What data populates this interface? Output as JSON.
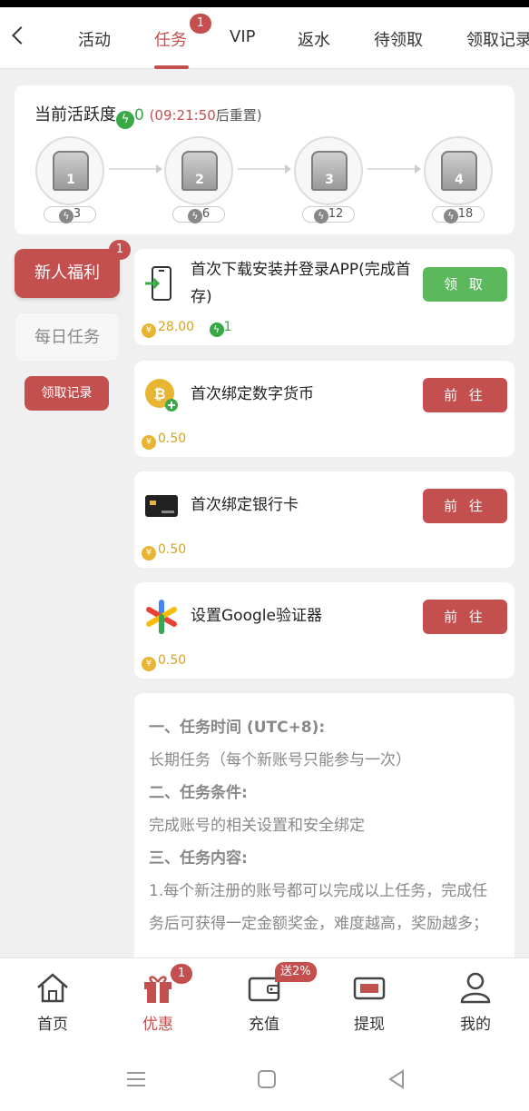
{
  "topnav": {
    "tabs": [
      {
        "label": "活动"
      },
      {
        "label": "任务",
        "badge": "1"
      },
      {
        "label": "VIP"
      },
      {
        "label": "返水"
      },
      {
        "label": "待领取"
      },
      {
        "label": "领取记录"
      }
    ],
    "active_tab": "任务"
  },
  "activity": {
    "title": "当前活跃度",
    "value": "0",
    "reset_time": "(09:21:50",
    "reset_suffix": "后重置)",
    "chests": [
      {
        "num": "1",
        "requirement": "3"
      },
      {
        "num": "2",
        "requirement": "6"
      },
      {
        "num": "3",
        "requirement": "12"
      },
      {
        "num": "4",
        "requirement": "18"
      }
    ]
  },
  "sidebar": {
    "items": [
      {
        "label": "新人福利",
        "badge": "1"
      },
      {
        "label": "每日任务"
      }
    ],
    "record_button": "领取记录"
  },
  "tasks": [
    {
      "title": "首次下载安装并登录APP(完成首存)",
      "button": "领 取",
      "reward": "28.00",
      "activity_reward": "1",
      "icon": "phone-download-icon"
    },
    {
      "title": "首次绑定数字货币",
      "button": "前 往",
      "reward": "0.50",
      "icon": "bitcoin-coin-icon"
    },
    {
      "title": "首次绑定银行卡",
      "button": "前 往",
      "reward": "0.50",
      "icon": "bank-card-icon"
    },
    {
      "title": "设置Google验证器",
      "button": "前 往",
      "reward": "0.50",
      "icon": "google-authenticator-icon"
    }
  ],
  "rules": {
    "h1": "一、任务时间 (UTC+8):",
    "p1": "长期任务（每个新账号只能参与一次）",
    "h2": "二、任务条件:",
    "p2": "完成账号的相关设置和安全绑定",
    "h3": "三、任务内容:",
    "p3": "1.每个新注册的账号都可以完成以上任务，完成任务后可获得一定金额奖金，难度越高，奖励越多；"
  },
  "bottom_nav": {
    "items": [
      {
        "label": "首页",
        "icon": "home-icon"
      },
      {
        "label": "优惠",
        "icon": "gift-icon",
        "badge": "1",
        "active": true
      },
      {
        "label": "充值",
        "icon": "wallet-icon",
        "promo": "送2%"
      },
      {
        "label": "提现",
        "icon": "withdraw-ticket-icon"
      },
      {
        "label": "我的",
        "icon": "user-icon"
      }
    ]
  },
  "colors": {
    "accent": "#c44f4f",
    "green": "#5cb85c",
    "activity_green": "#39a845",
    "coin": "#e7b531"
  }
}
